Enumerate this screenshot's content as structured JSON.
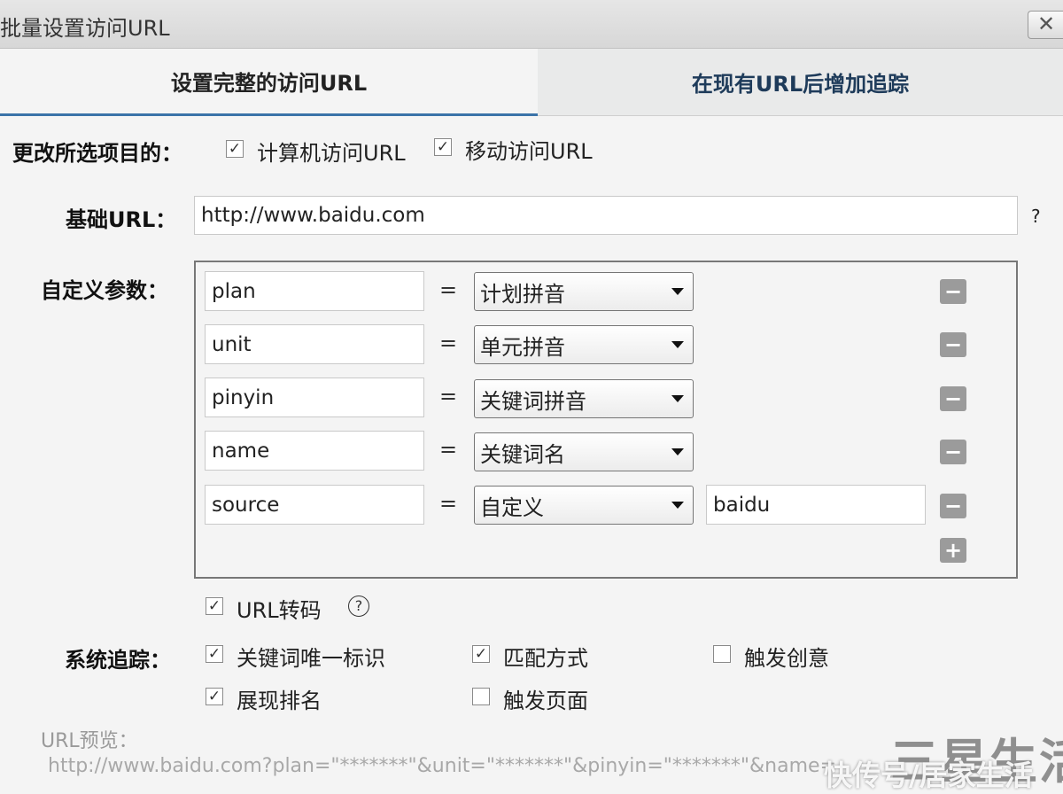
{
  "window": {
    "title": "批量设置访问URL",
    "close_glyph": "✕"
  },
  "tabs": [
    {
      "label": "设置完整的访问URL",
      "active": true
    },
    {
      "label": "在现有URL后增加追踪",
      "active": false
    }
  ],
  "change_selected": {
    "label": "更改所选项目的：",
    "options": [
      {
        "label": "计算机访问URL",
        "checked": true
      },
      {
        "label": "移动访问URL",
        "checked": true
      }
    ]
  },
  "base_url": {
    "label": "基础URL：",
    "value": "http://www.baidu.com",
    "help": "?"
  },
  "custom_params": {
    "label": "自定义参数：",
    "rows": [
      {
        "key": "plan",
        "op": "=",
        "value": "计划拼音",
        "extra": ""
      },
      {
        "key": "unit",
        "op": "=",
        "value": "单元拼音",
        "extra": ""
      },
      {
        "key": "pinyin",
        "op": "=",
        "value": "关键词拼音",
        "extra": ""
      },
      {
        "key": "name",
        "op": "=",
        "value": "关键词名",
        "extra": ""
      },
      {
        "key": "source",
        "op": "=",
        "value": "自定义",
        "extra": "baidu"
      }
    ],
    "remove_glyph": "−",
    "add_glyph": "+"
  },
  "url_encode": {
    "label": "URL转码",
    "checked": true,
    "help": "?"
  },
  "system_tracking": {
    "label": "系统追踪：",
    "options": [
      {
        "label": "关键词唯一标识",
        "checked": true
      },
      {
        "label": "匹配方式",
        "checked": true
      },
      {
        "label": "触发创意",
        "checked": false
      },
      {
        "label": "展现排名",
        "checked": true
      },
      {
        "label": "触发页面",
        "checked": false
      }
    ]
  },
  "preview": {
    "label": "URL预览：",
    "text": "http://www.baidu.com?plan=\"*******\"&unit=\"*******\"&pinyin=\"*******\"&name="
  },
  "watermark": {
    "main": "三星生活",
    "sub": "快传号/居家生活"
  },
  "colors": {
    "tab_underline": "#3b73a8",
    "inactive_tab_text": "#1e3b5a",
    "button_gray": "#9b9b9b"
  }
}
